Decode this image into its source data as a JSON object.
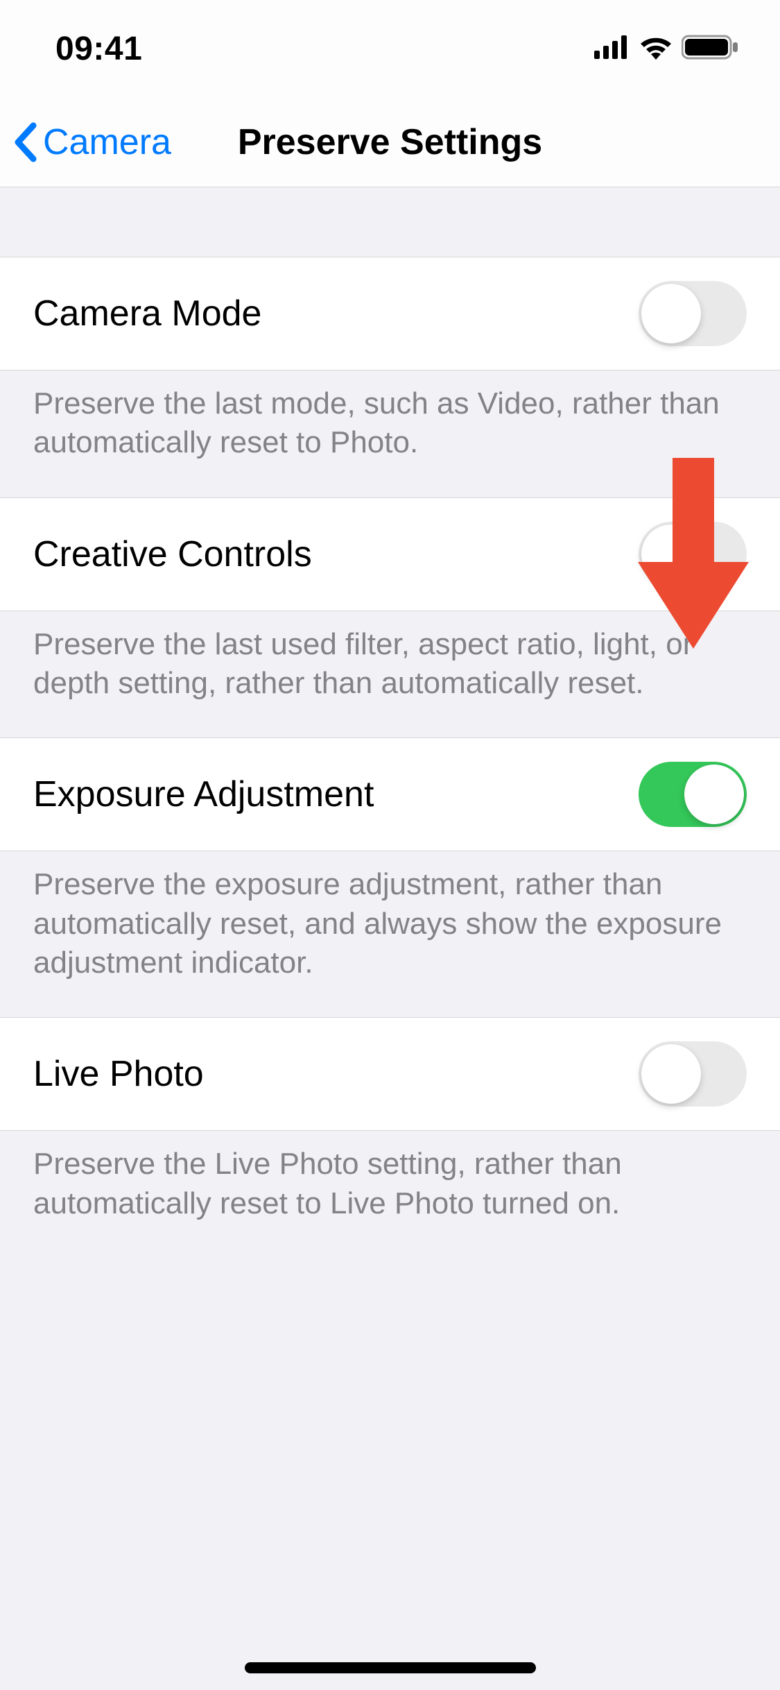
{
  "statusbar": {
    "time": "09:41"
  },
  "nav": {
    "back_label": "Camera",
    "title": "Preserve Settings"
  },
  "rows": {
    "camera_mode": {
      "label": "Camera Mode",
      "footer": "Preserve the last mode, such as Video, rather than automatically reset to Photo.",
      "on": false
    },
    "creative_controls": {
      "label": "Creative Controls",
      "footer": "Preserve the last used filter, aspect ratio, light, or depth setting, rather than automatically reset.",
      "on": false
    },
    "exposure_adjustment": {
      "label": "Exposure Adjustment",
      "footer": "Preserve the exposure adjustment, rather than automatically reset, and always show the exposure adjustment indicator.",
      "on": true
    },
    "live_photo": {
      "label": "Live Photo",
      "footer": "Preserve the Live Photo setting, rather than automatically reset to Live Photo turned on.",
      "on": false
    }
  },
  "colors": {
    "link": "#007aff",
    "toggle_on": "#34c759",
    "arrow": "#ed4a32"
  }
}
